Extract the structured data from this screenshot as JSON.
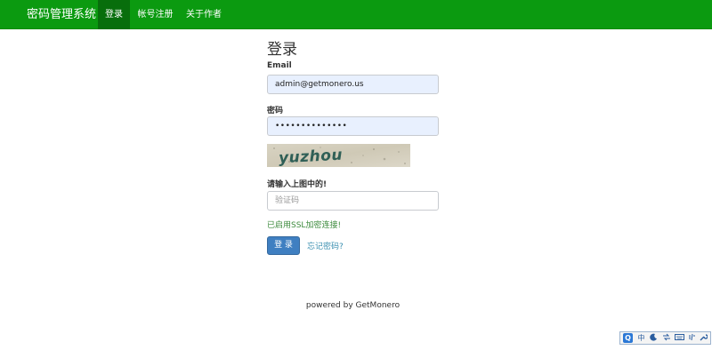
{
  "navbar": {
    "brand": "密码管理系统",
    "items": [
      {
        "label": "登录",
        "active": true
      },
      {
        "label": "帐号注册",
        "active": false
      },
      {
        "label": "关于作者",
        "active": false
      }
    ]
  },
  "form": {
    "title": "登录",
    "email_label": "Email",
    "email_value": "admin@getmonero.us",
    "password_label": "密码",
    "password_value": "••••••••••••••",
    "captcha_text": "yuzhou",
    "captcha_label": "请输入上图中的!",
    "captcha_placeholder": "验证码",
    "ssl_notice": "已启用SSL加密连接!",
    "login_button": "登 录",
    "forgot_link": "忘记密码?"
  },
  "footer": {
    "text": "powered by GetMonero"
  },
  "ime_toolbar": {
    "icons": [
      "ime-logo-icon",
      "chinese-mode-icon",
      "moon-icon",
      "arrows-icon",
      "keyboard-icon",
      "punctuation-icon",
      "wrench-icon"
    ],
    "chinese_mode": "中"
  }
}
